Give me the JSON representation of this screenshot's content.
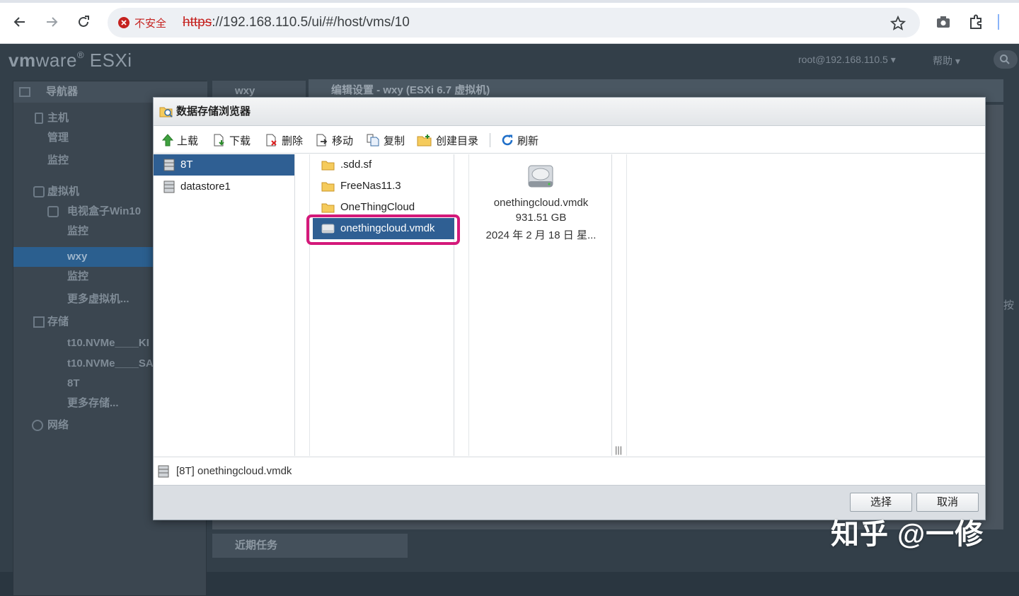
{
  "browser": {
    "security_label": "不安全",
    "url_protocol": "https",
    "url_rest": "://192.168.110.5/ui/#/host/vms/10"
  },
  "esxi": {
    "brand_vm": "vm",
    "brand_ware": "ware",
    "brand_product": "ESXi",
    "user_menu": "root@192.168.110.5 ▾",
    "help_menu": "帮助 ▾",
    "navigator_title": "导航器",
    "nav_items": {
      "host": "主机",
      "manage": "管理",
      "monitor": "监控",
      "vms": "虚拟机",
      "vm1": "电视盒子Win10",
      "vm1_monitor": "监控",
      "vm2": "wxy",
      "vm2_monitor": "监控",
      "more_vms": "更多虚拟机...",
      "storage": "存储",
      "ds1": "t10.NVMe____KI",
      "ds2": "t10.NVMe____SA",
      "ds3": "8T",
      "more_storage": "更多存储...",
      "network": "网络"
    },
    "tab_label": "wxy",
    "edit_settings_title": "编辑设置 - wxy (ESXi 6.7 虚拟机)",
    "recent_tasks": "近期任务",
    "side_fragment": "按"
  },
  "dialog": {
    "title": "数据存储浏览器",
    "toolbar": {
      "upload": "上载",
      "download": "下载",
      "delete": "删除",
      "move": "移动",
      "copy": "复制",
      "mkdir": "创建目录",
      "refresh": "刷新"
    },
    "datastores": [
      "8T",
      "datastore1"
    ],
    "entries": [
      ".sdd.sf",
      "FreeNas11.3",
      "OneThingCloud",
      "onethingcloud.vmdk"
    ],
    "detail": {
      "name": "onethingcloud.vmdk",
      "size": "931.51 GB",
      "date": "2024 年 2 月 18 日 星..."
    },
    "grip_char": "|||",
    "status_path": "[8T] onethingcloud.vmdk",
    "select_button": "选择",
    "cancel_button": "取消"
  },
  "watermark": "知乎 @一修"
}
